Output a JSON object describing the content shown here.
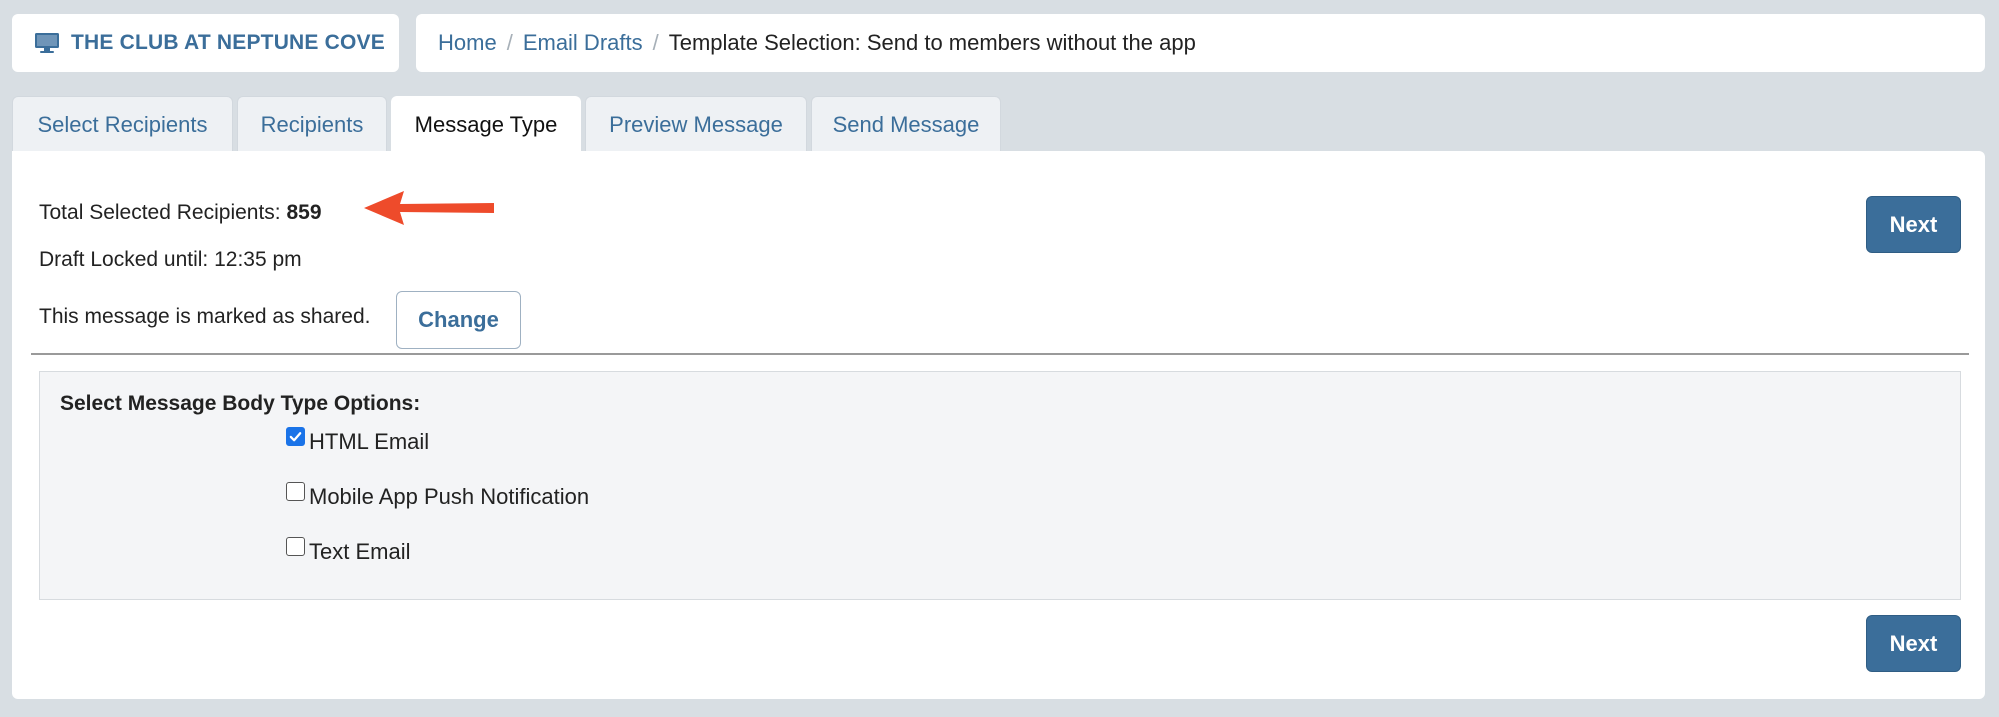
{
  "brand": {
    "name": "THE CLUB AT NEPTUNE COVE",
    "icon": "monitor-icon"
  },
  "breadcrumb": {
    "home": "Home",
    "sep1": "/",
    "drafts": "Email Drafts",
    "sep2": "/",
    "current": "Template Selection: Send to members without the app"
  },
  "tabs": [
    {
      "label": "Select Recipients",
      "active": false
    },
    {
      "label": "Recipients",
      "active": false
    },
    {
      "label": "Message Type",
      "active": true
    },
    {
      "label": "Preview Message",
      "active": false
    },
    {
      "label": "Send Message",
      "active": false
    }
  ],
  "summary": {
    "recipients_label": "Total Selected Recipients: ",
    "recipients_count": "859",
    "locked_text": "Draft Locked until: 12:35 pm",
    "shared_text": "This message is marked as shared.",
    "change_label": "Change"
  },
  "buttons": {
    "next_label": "Next"
  },
  "options": {
    "title": "Select Message Body Type Options:",
    "items": [
      {
        "label": "HTML Email",
        "checked": true
      },
      {
        "label": " Mobile App Push Notification",
        "checked": false
      },
      {
        "label": " Text Email",
        "checked": false
      }
    ]
  },
  "colors": {
    "accent": "#3b6e9a",
    "arrow": "#ee4b2b",
    "checkbox": "#1a73e8"
  }
}
